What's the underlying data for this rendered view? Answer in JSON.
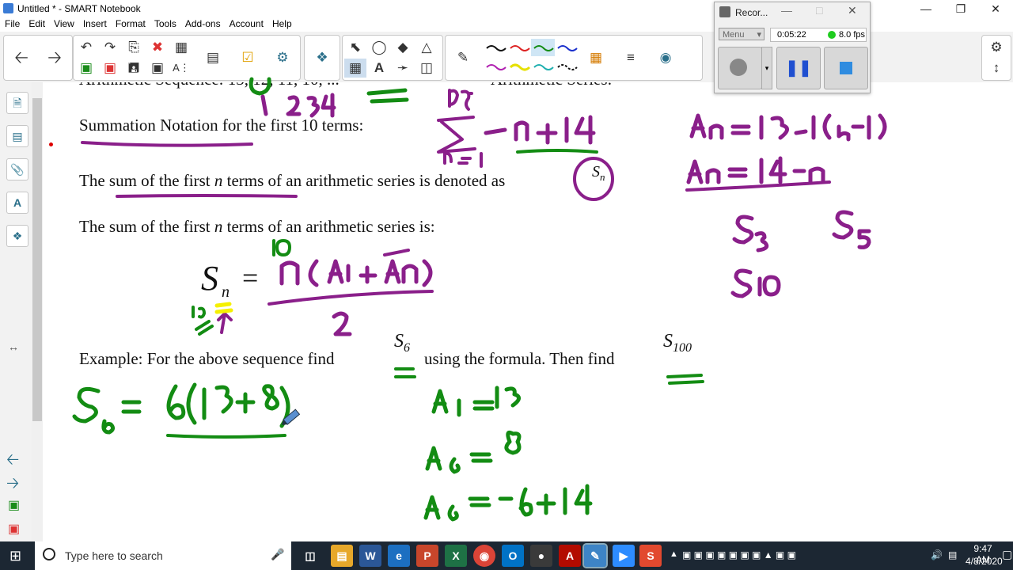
{
  "window": {
    "title": "Untitled * - SMART Notebook"
  },
  "menu": [
    "File",
    "Edit",
    "View",
    "Insert",
    "Format",
    "Tools",
    "Add-ons",
    "Account",
    "Help"
  ],
  "page": {
    "line_top": "Arithmetic Sequence: 13, 12, 11, 10, ...",
    "line_top_right": "Arithmetic Series:",
    "summation": "Summation Notation for the first 10 terms:",
    "sum_denoted_a": "The sum of the first",
    "sum_denoted_b": "terms of an arithmetic series is denoted as",
    "sum_is_a": "The sum of the first",
    "sum_is_b": "terms of an arithmetic series is:",
    "n_var": "n",
    "formula_S": "S",
    "formula_sub": "n",
    "formula_eq": "=",
    "sn_S": "S",
    "sn_sub": "n",
    "example_a": "Example:  For the above sequence find",
    "example_b": "using the formula.  Then find",
    "s6_S": "S",
    "s6_sub": "6",
    "s100_S": "S",
    "s100_sub": "100"
  },
  "recorder": {
    "title": "Recor...",
    "menu_label": "Menu",
    "time": "0:05:22",
    "fps": "8.0 fps",
    "status_color": "#1fcc1f"
  },
  "taskbar": {
    "search_placeholder": "Type here to search",
    "time": "9:47 AM",
    "date": "4/8/2020"
  },
  "ink_colors": {
    "purple": "#8a1f8a",
    "green": "#138c13",
    "yellow": "#f5f000"
  }
}
